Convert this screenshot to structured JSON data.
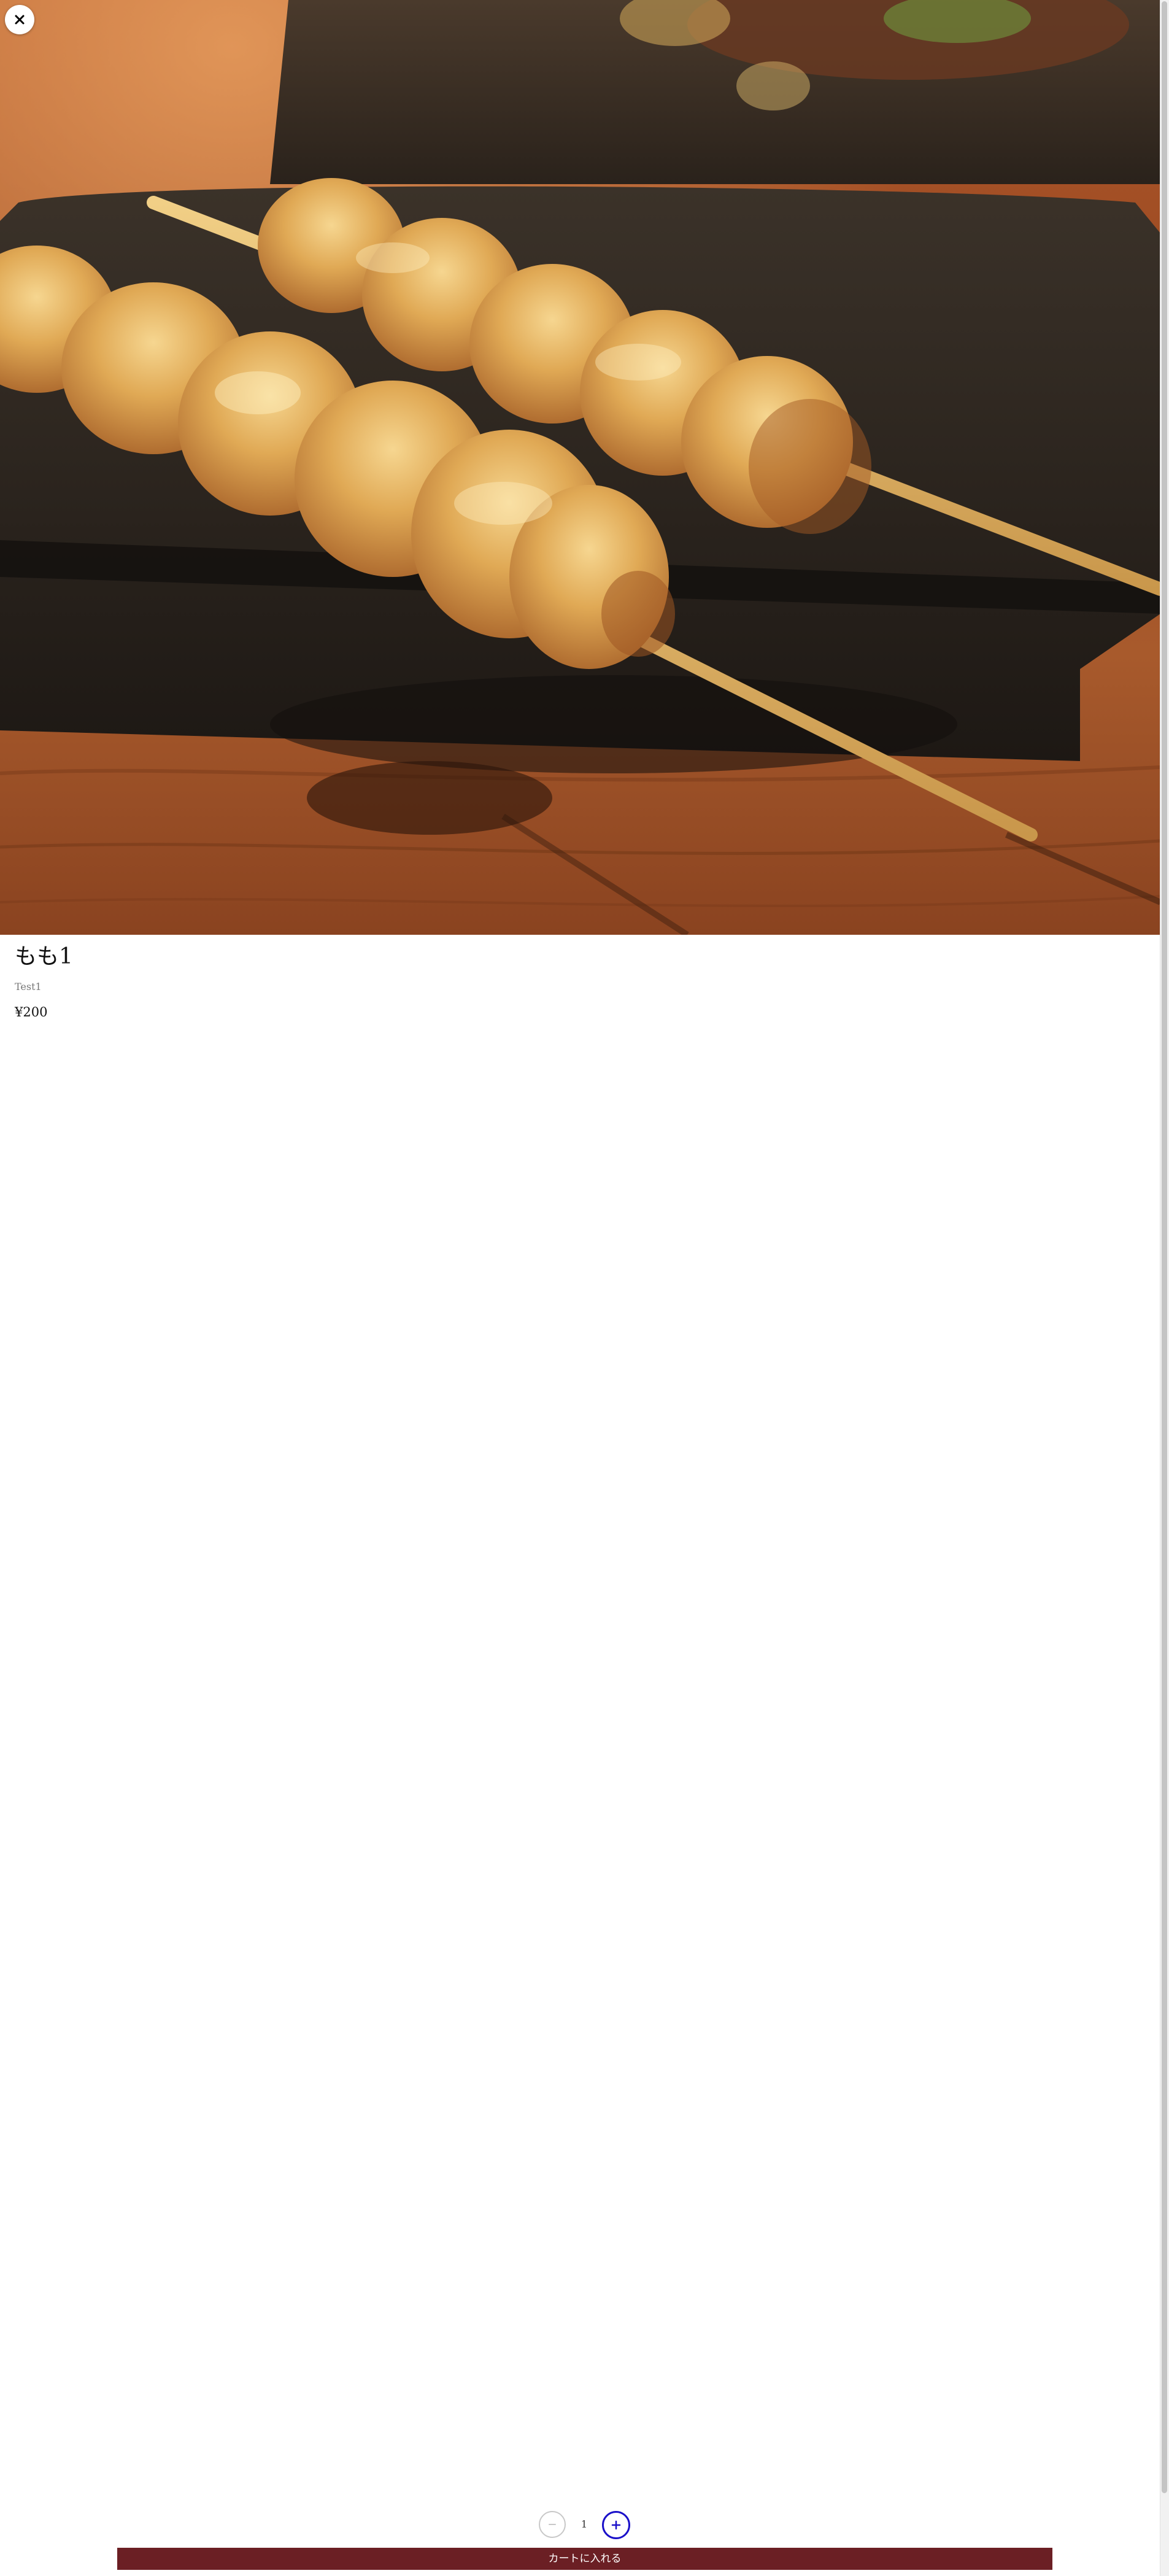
{
  "close_button": {
    "icon": "close-icon"
  },
  "hero_image": {
    "subject": "yakitori-skewers-photo"
  },
  "product": {
    "name": "もも1",
    "description": "Test1",
    "price": "¥200"
  },
  "quantity": {
    "value": "1",
    "decrement_icon": "minus-icon",
    "increment_icon": "plus-icon"
  },
  "cart_button": {
    "label": "カートに入れる"
  },
  "colors": {
    "cart_button_bg": "#6b1f24",
    "increment_accent": "#1a10c9",
    "decrement_border": "#c8c8c8",
    "description_text": "#777777"
  }
}
